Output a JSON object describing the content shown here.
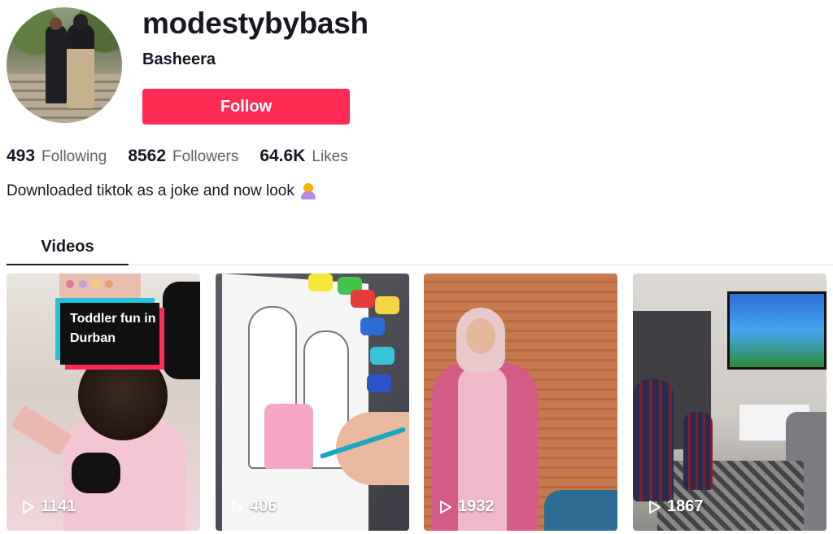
{
  "profile": {
    "username": "modestybybash",
    "display_name": "Basheera",
    "follow_label": "Follow",
    "bio": "Downloaded tiktok as a joke and now look"
  },
  "stats": [
    {
      "value": "493",
      "label": "Following"
    },
    {
      "value": "8562",
      "label": "Followers"
    },
    {
      "value": "64.6K",
      "label": "Likes"
    }
  ],
  "tabs": [
    {
      "label": "Videos",
      "active": true
    }
  ],
  "videos": [
    {
      "views": "1141",
      "overlay_text": "Toddler fun in Durban"
    },
    {
      "views": "406"
    },
    {
      "views": "1932"
    },
    {
      "views": "1867"
    }
  ],
  "colors": {
    "follow_button": "#fe2c55",
    "text_primary": "#161823",
    "text_secondary": "#5f6068"
  },
  "icons": {
    "play": "play-icon",
    "bio_emoji": "person-facepalming-emoji-icon"
  }
}
